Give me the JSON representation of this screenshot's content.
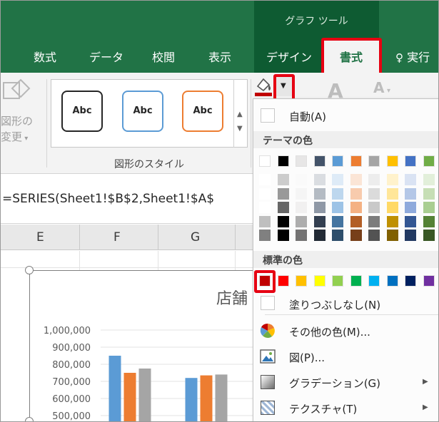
{
  "ribbon": {
    "tool_group_title": "グラフ ツール",
    "tabs": {
      "formulas": "数式",
      "data": "データ",
      "review": "校閲",
      "view": "表示",
      "design": "デザイン",
      "format": "書式",
      "tell_me": "実行"
    },
    "shape_change_label_1": "図形の",
    "shape_change_label_2": "変更",
    "style_samples": [
      "Abc",
      "Abc",
      "Abc"
    ],
    "styles_group_label": "図形のスタイル"
  },
  "formula_bar": {
    "text": "=SERIES(Sheet1!$B$2,Sheet1!$A$"
  },
  "sheet": {
    "columns": [
      "E",
      "F",
      "G"
    ]
  },
  "chart": {
    "title_partial": "店舗"
  },
  "chart_data": {
    "type": "bar",
    "title": "店舗",
    "xlabel": "",
    "ylabel": "",
    "ylim": [
      500000,
      1000000
    ],
    "tick_labels": [
      "1,000,000",
      "900,000",
      "800,000",
      "700,000",
      "600,000",
      "500,000"
    ],
    "categories": [
      "",
      ""
    ],
    "series": [
      {
        "values": [
          850000,
          720000
        ],
        "color": "#5b9bd5"
      },
      {
        "values": [
          750000,
          735000
        ],
        "color": "#ed7d31"
      },
      {
        "values": [
          775000,
          740000
        ],
        "color": "#a5a5a5"
      }
    ]
  },
  "color_menu": {
    "automatic": "自動(A)",
    "theme_colors_header": "テーマの色",
    "theme_colors": [
      "#ffffff",
      "#000000",
      "#e7e6e6",
      "#44546a",
      "#5b9bd5",
      "#ed7d31",
      "#a5a5a5",
      "#ffc000",
      "#4472c4",
      "#70ad47"
    ],
    "standard_colors_header": "標準の色",
    "standard_colors": [
      "#c00000",
      "#ff0000",
      "#ffc000",
      "#ffff00",
      "#92d050",
      "#00b050",
      "#00b0f0",
      "#0070c0",
      "#002060",
      "#7030a0"
    ],
    "no_fill": "塗りつぶしなし(N)",
    "more_colors": "その他の色(M)...",
    "picture": "図(P)...",
    "gradient": "グラデーション(G)",
    "texture": "テクスチャ(T)"
  },
  "colors": {
    "ribbon_green": "#217346",
    "highlight_red": "#e60012"
  }
}
